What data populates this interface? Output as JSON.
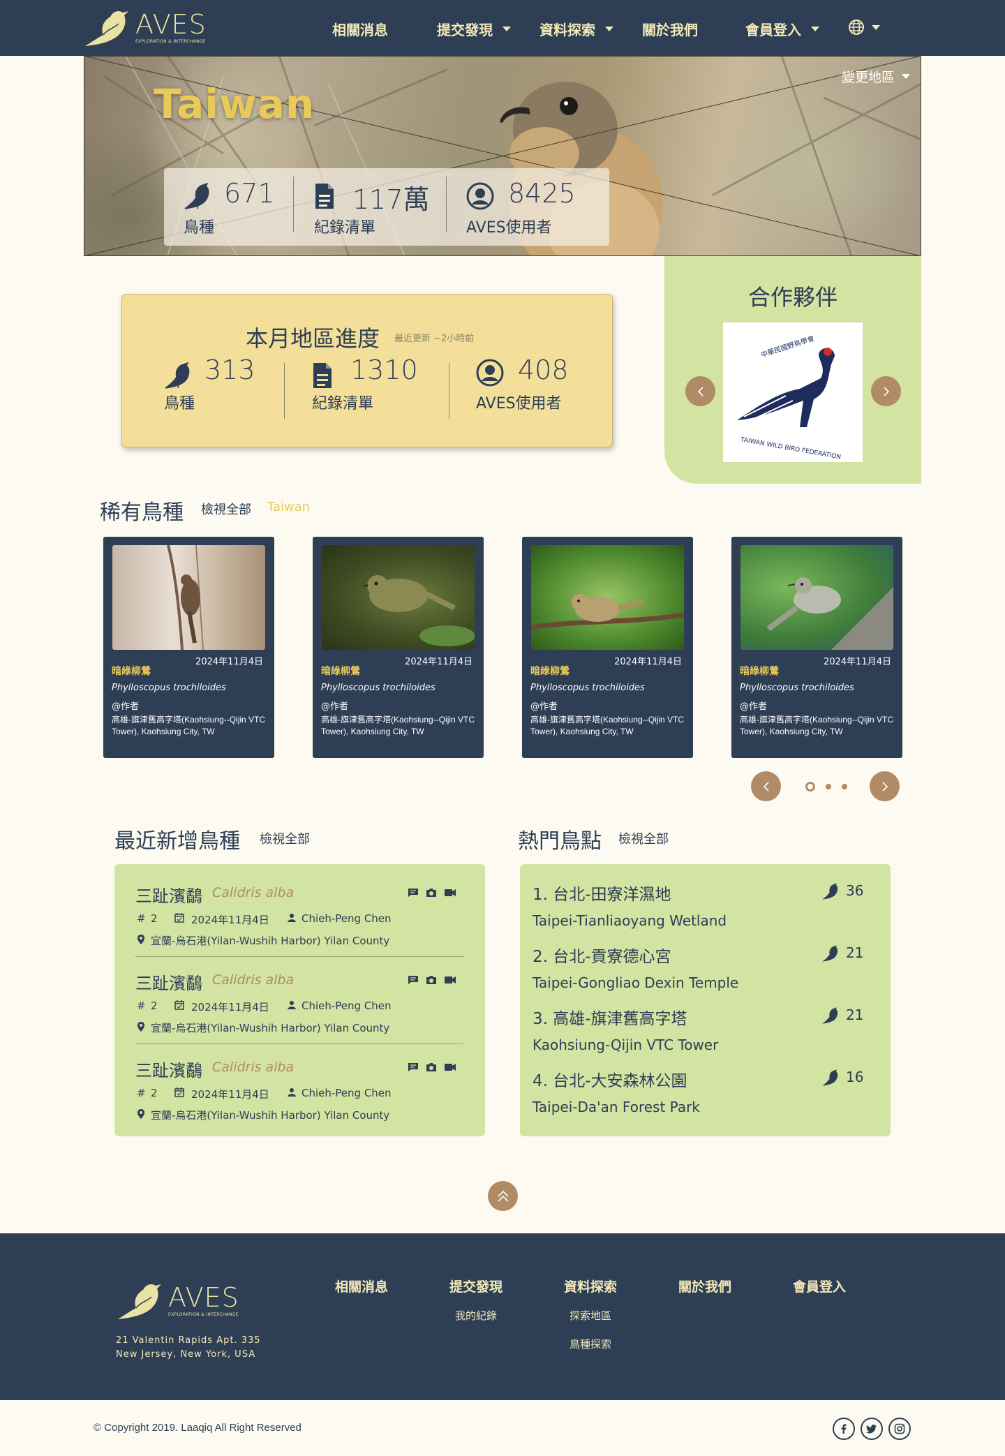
{
  "header": {
    "logo_word": "AVES",
    "logo_sub": "EXPLORATION & INTERCHANGE",
    "nav": [
      {
        "label": "相關消息"
      },
      {
        "label": "提交發現"
      },
      {
        "label": "資料探索"
      },
      {
        "label": "關於我們"
      },
      {
        "label": "會員登入"
      }
    ],
    "language_icon": "globe-icon"
  },
  "hero": {
    "title": "Taiwan",
    "change_region": "變更地區",
    "stats": [
      {
        "icon": "bird-icon",
        "value": "671",
        "label": "鳥種"
      },
      {
        "icon": "document-icon",
        "value": "117萬",
        "label": "紀錄清單"
      },
      {
        "icon": "user-icon",
        "value": "8425",
        "label": "AVES使用者"
      }
    ]
  },
  "monthly": {
    "title": "本月地區進度",
    "updated": "最近更新 ~2小時前",
    "stats": [
      {
        "icon": "bird-icon",
        "value": "313",
        "label": "鳥種"
      },
      {
        "icon": "document-icon",
        "value": "1310",
        "label": "紀錄清單"
      },
      {
        "icon": "user-icon",
        "value": "408",
        "label": "AVES使用者"
      }
    ]
  },
  "partners": {
    "title": "合作夥伴",
    "logo_text_cn": "中華民國野鳥學會",
    "logo_text_en": "TAIWAN WILD BIRD FEDERATION"
  },
  "rare": {
    "title": "稀有鳥種",
    "view_all": "檢視全部",
    "region": "Taiwan",
    "cards": [
      {
        "date": "2024年11月4日",
        "name": "暗綠柳鶯",
        "sci": "Phylloscopus trochiloides",
        "author": "@作者",
        "location": "高雄-旗津舊高字塔(Kaohsiung--Qijin VTC Tower), Kaohsiung City, TW"
      },
      {
        "date": "2024年11月4日",
        "name": "暗綠柳鶯",
        "sci": "Phylloscopus trochiloides",
        "author": "@作者",
        "location": "高雄-旗津舊高字塔(Kaohsiung--Qijin VTC Tower), Kaohsiung City, TW"
      },
      {
        "date": "2024年11月4日",
        "name": "暗綠柳鶯",
        "sci": "Phylloscopus trochiloides",
        "author": "@作者",
        "location": "高雄-旗津舊高字塔(Kaohsiung--Qijin VTC Tower), Kaohsiung City, TW"
      },
      {
        "date": "2024年11月4日",
        "name": "暗綠柳鶯",
        "sci": "Phylloscopus trochiloides",
        "author": "@作者",
        "location": "高雄-旗津舊高字塔(Kaohsiung--Qijin VTC Tower), Kaohsiung City, TW"
      }
    ],
    "page_count": 3,
    "active_page": 1
  },
  "recent": {
    "title": "最近新增鳥種",
    "view_all": "檢視全部",
    "items": [
      {
        "name": "三趾濱鷸",
        "sci": "Calidris alba",
        "count_prefix": "#",
        "count": "2",
        "date": "2024年11月4日",
        "user": "Chieh-Peng Chen",
        "place": "宜蘭-烏石港(Yilan-Wushih Harbor) Yilan County"
      },
      {
        "name": "三趾濱鷸",
        "sci": "Calidris alba",
        "count_prefix": "#",
        "count": "2",
        "date": "2024年11月4日",
        "user": "Chieh-Peng Chen",
        "place": "宜蘭-烏石港(Yilan-Wushih Harbor) Yilan County"
      },
      {
        "name": "三趾濱鷸",
        "sci": "Calidris alba",
        "count_prefix": "#",
        "count": "2",
        "date": "2024年11月4日",
        "user": "Chieh-Peng Chen",
        "place": "宜蘭-烏石港(Yilan-Wushih Harbor) Yilan County"
      }
    ]
  },
  "hotspots": {
    "title": "熱門鳥點",
    "view_all": "檢視全部",
    "items": [
      {
        "name": "1. 台北-田寮洋濕地",
        "en": "Taipei-Tianliaoyang Wetland",
        "count": "36"
      },
      {
        "name": "2. 台北-貢寮德心宮",
        "en": "Taipei-Gongliao Dexin Temple",
        "count": "21"
      },
      {
        "name": "3. 高雄-旗津舊高字塔",
        "en": "Kaohsiung-Qijin VTC Tower",
        "count": "21"
      },
      {
        "name": "4. 台北-大安森林公園",
        "en": "Taipei-Da'an Forest Park",
        "count": "16"
      }
    ]
  },
  "footer": {
    "logo_word": "AVES",
    "logo_sub": "EXPLORATION & INTERCHANGE",
    "address_line1": "21 Valentin Rapids Apt. 335",
    "address_line2": "New Jersey, New York, USA",
    "columns": [
      {
        "title": "相關消息",
        "links": []
      },
      {
        "title": "提交發現",
        "links": [
          "我的紀錄"
        ]
      },
      {
        "title": "資料探索",
        "links": [
          "探索地區",
          "鳥種探索"
        ]
      },
      {
        "title": "關於我們",
        "links": []
      },
      {
        "title": "會員登入",
        "links": []
      }
    ],
    "copyright": "© Copyright 2019. Laaqiq All Right Reserved",
    "social": [
      "facebook-icon",
      "twitter-icon",
      "instagram-icon"
    ]
  },
  "colors": {
    "navy": "#2d3e55",
    "cream": "#fdfbf1",
    "yellow": "#f3df9a",
    "green": "#d2e3a2",
    "brown": "#b08b66",
    "gold": "#e8c95a"
  }
}
